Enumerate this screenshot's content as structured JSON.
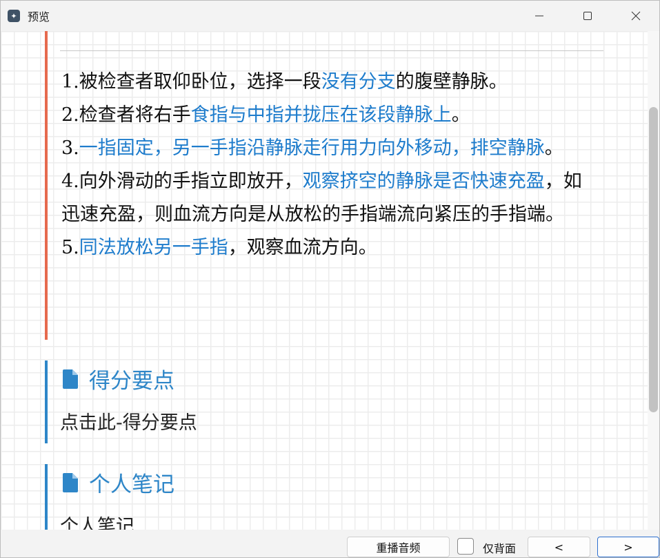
{
  "window": {
    "title": "预览"
  },
  "steps": [
    {
      "num": "1.",
      "parts": [
        {
          "text": "被检查者取仰卧位，选择一段",
          "hl": false
        },
        {
          "text": "没有分支",
          "hl": true
        },
        {
          "text": "的腹壁静脉。",
          "hl": false
        }
      ]
    },
    {
      "num": "2.",
      "parts": [
        {
          "text": "检查者将右手",
          "hl": false
        },
        {
          "text": "食指与中指并拢压在该段静脉上",
          "hl": true
        },
        {
          "text": "。",
          "hl": false
        }
      ]
    },
    {
      "num": "3.",
      "parts": [
        {
          "text": "一指固定，另一手指沿静脉走行用力向外移动，排空静脉",
          "hl": true
        },
        {
          "text": "。",
          "hl": false
        }
      ]
    },
    {
      "num": "4.",
      "parts": [
        {
          "text": "向外滑动的手指立即放开，",
          "hl": false
        },
        {
          "text": "观察挤空的静脉是否快速充盈",
          "hl": true
        },
        {
          "text": "，如迅速充盈，则血流方向是从放松的手指端流向紧压的手指端。",
          "hl": false
        }
      ]
    },
    {
      "num": "5.",
      "parts": [
        {
          "text": "同法放松另一手指",
          "hl": true
        },
        {
          "text": "，观察血流方向。",
          "hl": false
        }
      ]
    }
  ],
  "sections": [
    {
      "title": "得分要点",
      "body": "点击此-得分要点"
    },
    {
      "title": "个人笔记",
      "body": "个人笔记"
    }
  ],
  "bottom": {
    "replay_label": "重播音频",
    "back_only_label": "仅背面",
    "prev_label": "<",
    "next_label": ">"
  },
  "colors": {
    "accent_blue": "#2e86c8",
    "highlight_blue": "#1e7ccc",
    "steps_border": "#e66a4e"
  }
}
